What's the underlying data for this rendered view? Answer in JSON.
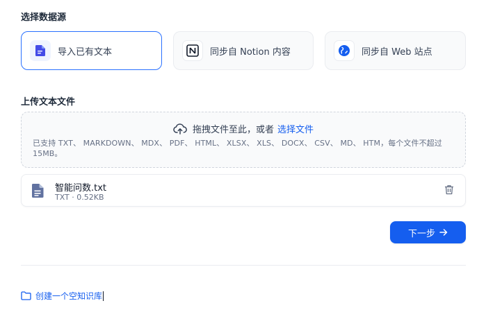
{
  "data_source": {
    "section_title": "选择数据源",
    "options": [
      {
        "label": "导入已有文本",
        "icon": "document-icon",
        "selected": true
      },
      {
        "label": "同步自 Notion 内容",
        "icon": "notion-logo-icon",
        "selected": false
      },
      {
        "label": "同步自 Web 站点",
        "icon": "web-globe-icon",
        "selected": false
      }
    ]
  },
  "upload": {
    "section_title": "上传文本文件",
    "drop_text": "拖拽文件至此，或者",
    "select_link": "选择文件",
    "supported_hint": "已支持 TXT、 MARKDOWN、 MDX、 PDF、 HTML、 XLSX、 XLS、 DOCX、 CSV、 MD、 HTM，每个文件不超过 15MB。"
  },
  "files": [
    {
      "name": "智能问数.txt",
      "meta": "TXT · 0.52KB"
    }
  ],
  "actions": {
    "next_label": "下一步"
  },
  "footer": {
    "create_empty_label": "创建一个空知识库"
  },
  "colors": {
    "accent": "#155eef",
    "selected_border": "#2970ff",
    "card_bg": "#f9fafb",
    "border": "#eaecf0"
  }
}
